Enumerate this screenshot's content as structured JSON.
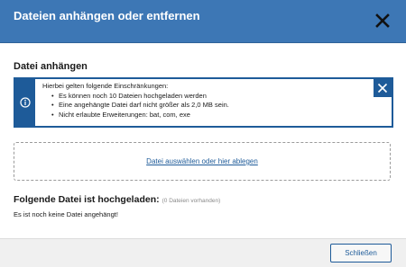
{
  "dialog": {
    "title": "Dateien anhängen oder entfernen"
  },
  "attach": {
    "section_title": "Datei anhängen",
    "info": {
      "intro": "Hierbei gelten folgende Einschränkungen:",
      "items": [
        "Es können noch 10 Dateien hochgeladen werden",
        "Eine angehängte Datei darf nicht größer als 2,0 MB sein.",
        "Nicht erlaubte Erweiterungen: bat, com, exe"
      ]
    },
    "dropzone_label": "Datei auswählen oder hier ablegen"
  },
  "uploaded": {
    "title": "Folgende Datei ist hochgeladen:",
    "count_label": "(0 Dateien vorhanden)",
    "empty_message": "Es ist noch keine Datei angehängt!"
  },
  "footer": {
    "close_label": "Schließen"
  },
  "colors": {
    "header": "#3d77b5",
    "accent": "#1e5b99"
  },
  "icons": {
    "header_close": "close-icon",
    "info": "info-icon",
    "info_close": "close-icon"
  }
}
